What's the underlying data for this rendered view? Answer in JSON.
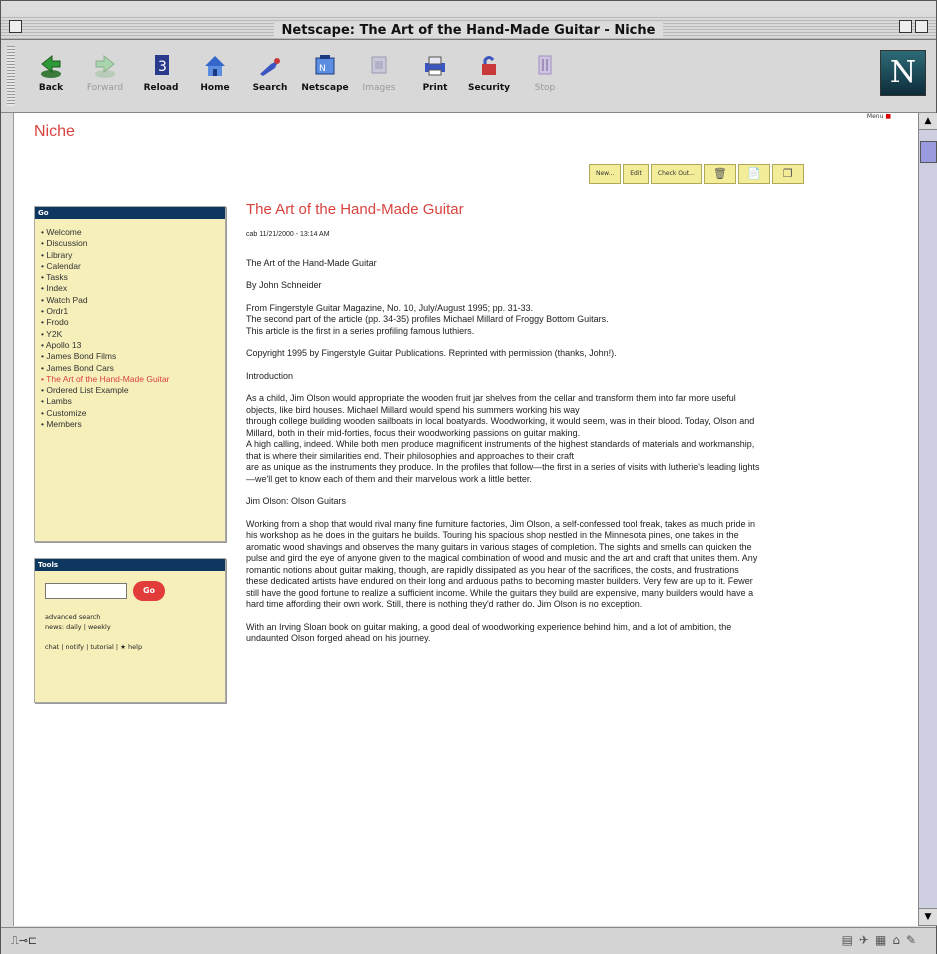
{
  "window": {
    "title": "Netscape: The Art of the Hand-Made Guitar - Niche"
  },
  "toolbar": {
    "buttons": [
      {
        "label": "Back",
        "icon": "back-arrow-icon",
        "enabled": true
      },
      {
        "label": "Forward",
        "icon": "forward-arrow-icon",
        "enabled": false
      },
      {
        "label": "Reload",
        "icon": "reload-icon",
        "enabled": true
      },
      {
        "label": "Home",
        "icon": "home-icon",
        "enabled": true
      },
      {
        "label": "Search",
        "icon": "search-icon",
        "enabled": true
      },
      {
        "label": "Netscape",
        "icon": "netscape-icon",
        "enabled": true
      },
      {
        "label": "Images",
        "icon": "images-icon",
        "enabled": false
      },
      {
        "label": "Print",
        "icon": "print-icon",
        "enabled": true
      },
      {
        "label": "Security",
        "icon": "security-icon",
        "enabled": true
      },
      {
        "label": "Stop",
        "icon": "stop-icon",
        "enabled": false
      }
    ],
    "logo_letter": "N"
  },
  "page": {
    "site_name": "Niche",
    "menu_link": "Menu",
    "actions": [
      "New...",
      "Edit",
      "Check Out...",
      "trash-icon",
      "page-icon",
      "copy-icon"
    ],
    "nav": {
      "header": "Go",
      "items": [
        "• Welcome",
        "• Discussion",
        "• Library",
        "• Calendar",
        "• Tasks",
        "• Index",
        "• Watch Pad",
        "• Ordr1",
        "• Frodo",
        "• Y2K",
        "• Apollo 13",
        "• James Bond Films",
        "• James Bond Cars",
        "• The Art of the Hand-Made Guitar",
        "• Ordered List Example",
        "• Lambs",
        "• Customize",
        "• Members"
      ],
      "current_index": 13
    },
    "tools": {
      "header": "Tools",
      "search_value": "",
      "go_label": "Go",
      "advanced_search": "advanced search",
      "news_links": "news: daily | weekly",
      "footer_links": "chat | notify | tutorial | ★ help"
    },
    "article": {
      "title": "The Art of the Hand-Made Guitar",
      "meta": "cab 11/21/2000 - 13:14 AM",
      "paragraphs": [
        "The Art of the Hand-Made Guitar",
        "By John Schneider",
        "From Fingerstyle Guitar Magazine, No. 10, July/August 1995; pp. 31-33.\nThe second part of the article (pp. 34-35) profiles Michael Millard of Froggy Bottom Guitars.\nThis article is the first in a series profiling famous luthiers.",
        "Copyright 1995 by Fingerstyle Guitar Publications. Reprinted with permission (thanks, John!).",
        "Introduction",
        "As a child, Jim Olson would appropriate the wooden fruit jar shelves from the cellar and transform them into far more useful objects, like bird houses. Michael Millard would spend his summers working his way\nthrough college building wooden sailboats in local boatyards. Woodworking, it would seem, was in their blood. Today, Olson and Millard, both in their mid-forties, focus their woodworking passions on guitar making.\nA high calling, indeed. While both men produce magnificent instruments of the highest standards of materials and workmanship, that is where their similarities end. Their philosophies and approaches to their craft\nare as unique as the instruments they produce. In the profiles that follow—the first in a series of visits with lutherie's leading lights—we'll get to know each of them and their marvelous work a little better.",
        "Jim Olson: Olson Guitars",
        "Working from a shop that would rival many fine furniture factories, Jim Olson, a self-confessed tool freak, takes as much pride in his workshop as he does in the guitars he builds. Touring his spacious shop nestled in the Minnesota pines, one takes in the aromatic wood shavings and observes the many guitars in various stages of completion. The sights and smells can quicken the pulse and gird the eye of anyone given to the magical combination of wood and music and the art and craft that unites them. Any romantic notions about guitar making, though, are rapidly dissipated as you hear of the sacrifices, the costs, and frustrations these dedicated artists have endured on their long and arduous paths to becoming master builders. Very few are up to it. Fewer still have the good fortune to realize a sufficient income. While the guitars they build are expensive, many builders would have a hard time affording their own work. Still, there is nothing they'd rather do. Jim Olson is no exception.",
        "With an Irving Sloan book on guitar making, a good deal of woodworking experience behind him, and a lot of ambition, the undaunted Olson forged ahead on his journey."
      ]
    }
  },
  "colors": {
    "accent_red": "#d9433e",
    "nav_header": "#0e3760",
    "sidebar_bg": "#f6efb9",
    "action_bg": "#f3ec99"
  }
}
